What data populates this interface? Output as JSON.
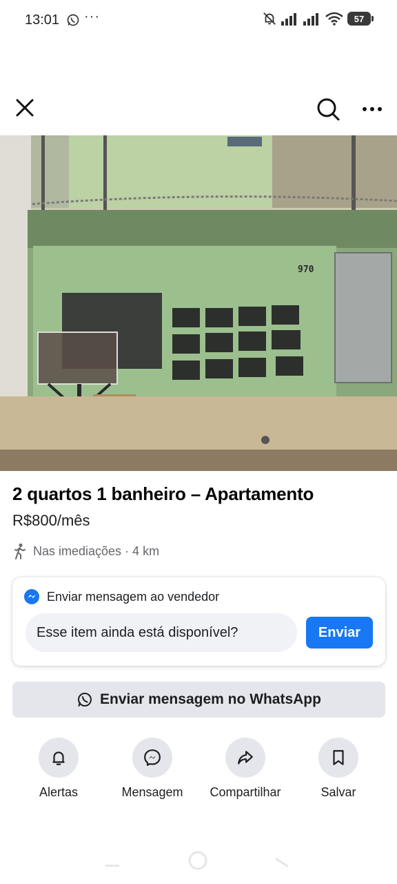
{
  "status_bar": {
    "time": "13:01",
    "overflow": "···",
    "battery": "57",
    "icons": [
      "whatsapp-icon",
      "mute-bell-icon",
      "signal-icon",
      "signal-icon",
      "wifi-icon",
      "battery-icon"
    ]
  },
  "header": {
    "icons": [
      "close-icon",
      "search-icon",
      "more-icon"
    ]
  },
  "listing": {
    "title": "2 quartos 1 banheiro – Apartamento",
    "price": "R$800/mês",
    "location": "Nas imediações · 4 km",
    "building_number": "970"
  },
  "message_card": {
    "header": "Enviar mensagem ao vendedor",
    "input_value": "Esse item ainda está disponível?",
    "send_label": "Enviar"
  },
  "whatsapp_button": {
    "label": "Enviar mensagem no WhatsApp"
  },
  "actions": [
    {
      "label": "Alertas",
      "icon": "bell-icon"
    },
    {
      "label": "Mensagem",
      "icon": "messenger-icon"
    },
    {
      "label": "Compartilhar",
      "icon": "share-icon"
    },
    {
      "label": "Salvar",
      "icon": "bookmark-icon"
    }
  ],
  "colors": {
    "accent": "#1877f2",
    "button_gray": "#e4e6eb",
    "input_gray": "#f0f2f5",
    "secondary_text": "#65676b"
  }
}
